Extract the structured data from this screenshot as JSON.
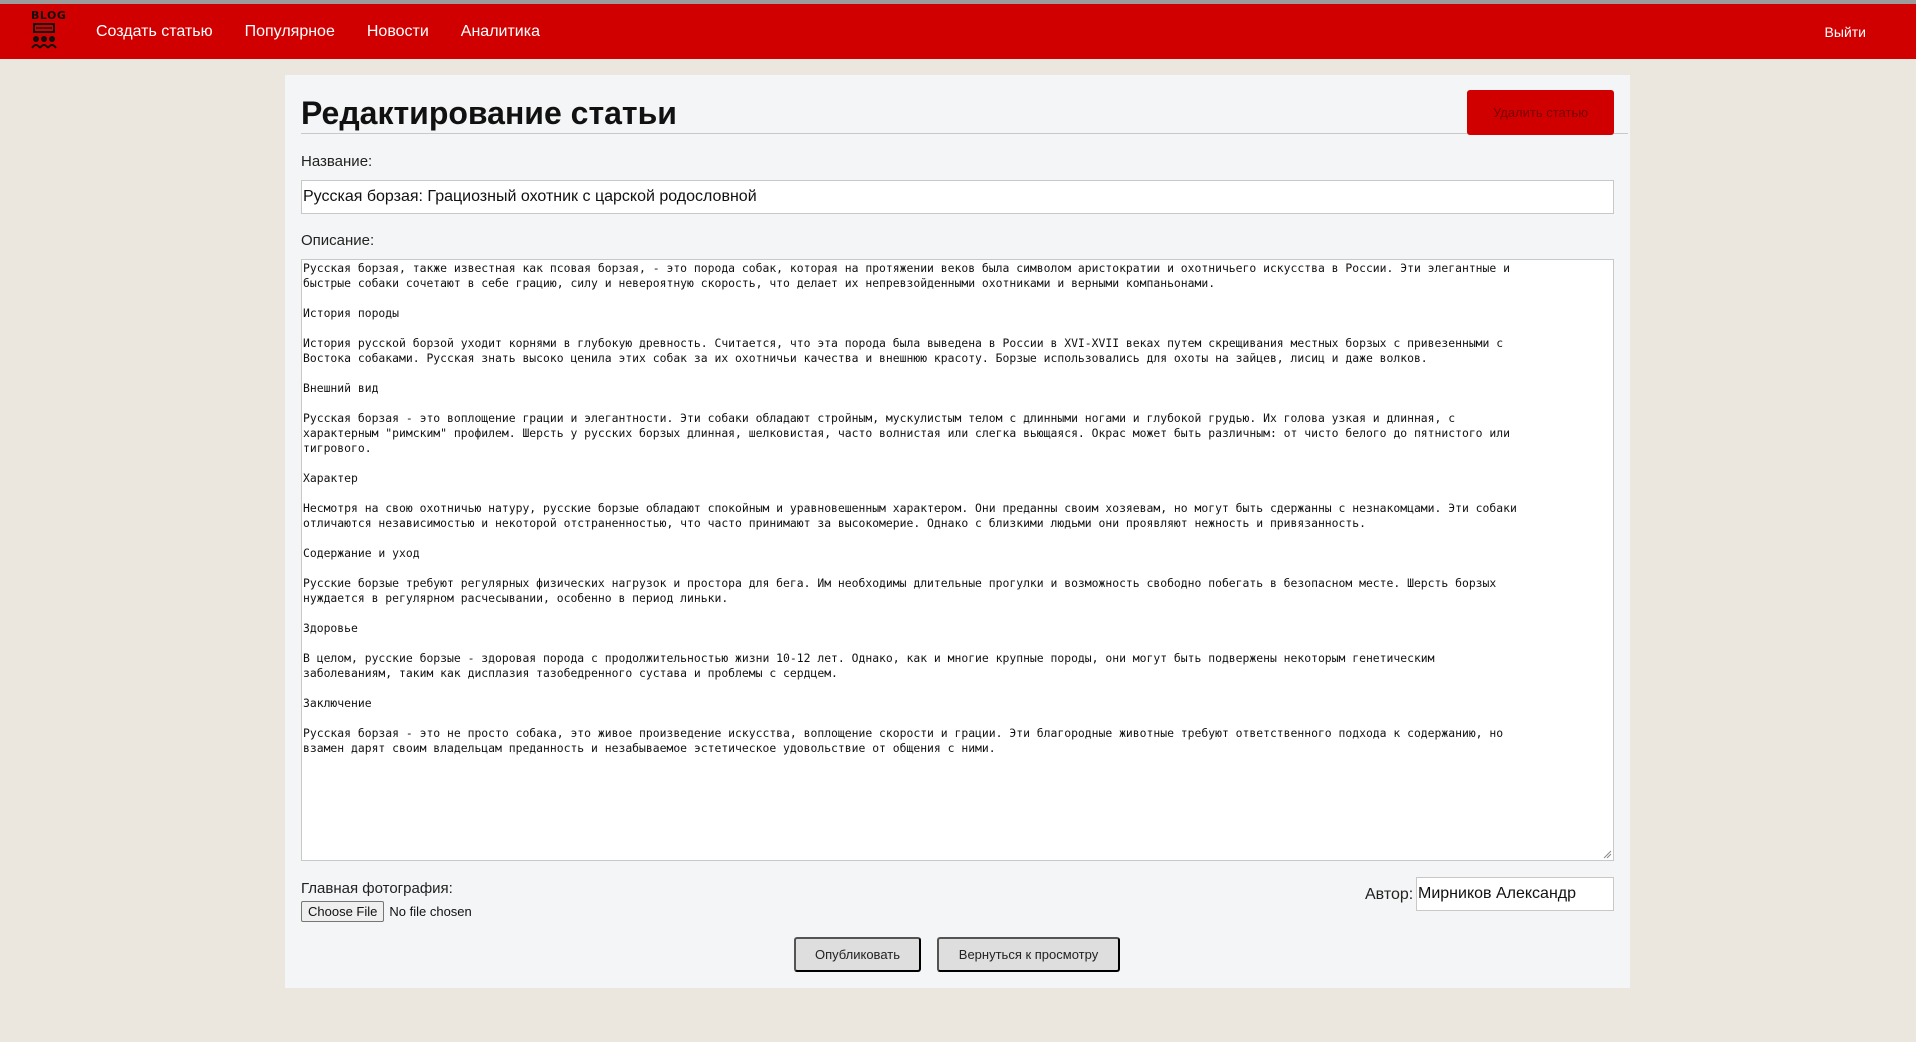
{
  "nav": {
    "logo_text": "BLOG",
    "items": [
      "Создать статью",
      "Популярное",
      "Новости",
      "Аналитика"
    ],
    "logout_label": "Выйти"
  },
  "page": {
    "title": "Редактирование статьи",
    "delete_label": "Удалить статью"
  },
  "form": {
    "title_label": "Название:",
    "title_value": "Русская борзая: Грациозный охотник с царской родословной",
    "description_label": "Описание:",
    "description_value": "Русская борзая, также известная как псовая борзая, - это порода собак, которая на протяжении веков была символом аристократии и охотничьего искусства в России. Эти элегантные и\nбыстрые собаки сочетают в себе грацию, силу и невероятную скорость, что делает их непревзойденными охотниками и верными компаньонами.\n\nИстория породы\n\nИстория русской борзой уходит корнями в глубокую древность. Считается, что эта порода была выведена в России в XVI-XVII веках путем скрещивания местных борзых с привезенными с\nВостока собаками. Русская знать высоко ценила этих собак за их охотничьи качества и внешнюю красоту. Борзые использовались для охоты на зайцев, лисиц и даже волков.\n\nВнешний вид\n\nРусская борзая - это воплощение грации и элегантности. Эти собаки обладают стройным, мускулистым телом с длинными ногами и глубокой грудью. Их голова узкая и длинная, с\nхарактерным \"римским\" профилем. Шерсть у русских борзых длинная, шелковистая, часто волнистая или слегка вьющаяся. Окрас может быть различным: от чисто белого до пятнистого или\nтигрового.\n\nХарактер\n\nНесмотря на свою охотничью натуру, русские борзые обладают спокойным и уравновешенным характером. Они преданны своим хозяевам, но могут быть сдержанны с незнакомцами. Эти собаки\nотличаются независимостью и некоторой отстраненностью, что часто принимают за высокомерие. Однако с близкими людьми они проявляют нежность и привязанность.\n\nСодержание и уход\n\nРусские борзые требуют регулярных физических нагрузок и простора для бега. Им необходимы длительные прогулки и возможность свободно побегать в безопасном месте. Шерсть борзых\nнуждается в регулярном расчесывании, особенно в период линьки.\n\nЗдоровье\n\nВ целом, русские борзые - здоровая порода с продолжительностью жизни 10-12 лет. Однако, как и многие крупные породы, они могут быть подвержены некоторым генетическим\nзаболеваниям, таким как дисплазия тазобедренного сустава и проблемы с сердцем.\n\nЗаключение\n\nРусская борзая - это не просто собака, это живое произведение искусства, воплощение скорости и грации. Эти благородные животные требуют ответственного подхода к содержанию, но\nвзамен дарят своим владельцам преданность и незабываемое эстетическое удовольствие от общения с ними.",
    "photo_label": "Главная фотография:",
    "file_button_label": "Choose File",
    "file_status": "No file chosen",
    "author_label": "Автор:",
    "author_value": "Мирников Александр"
  },
  "actions": {
    "publish_label": "Опубликовать",
    "back_label": "Вернуться к просмотру"
  },
  "colors": {
    "brand_red": "#d10000",
    "page_bg": "#ebe7df",
    "card_bg": "#f4f5f6"
  }
}
